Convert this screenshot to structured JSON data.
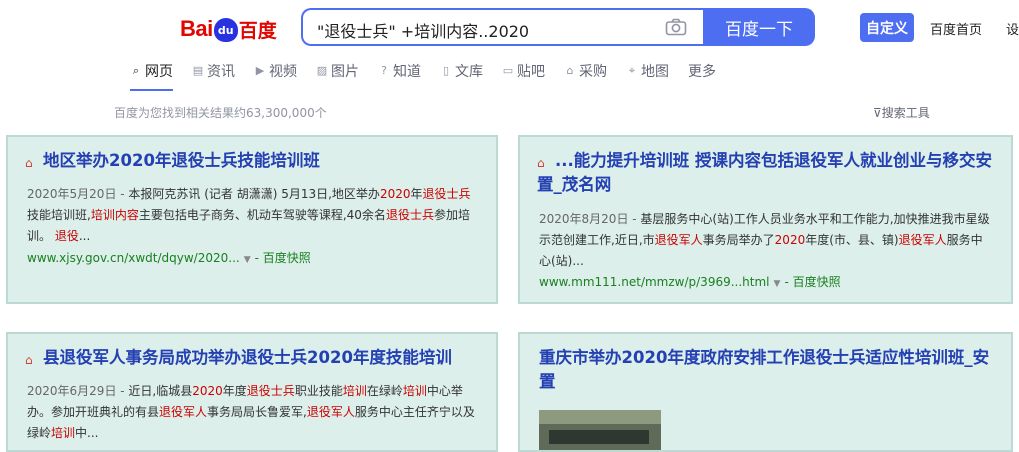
{
  "logo": {
    "text_bai": "Bai",
    "text_du": "du",
    "text_cn": "百度"
  },
  "search": {
    "query": "\"退役士兵\" +培训内容..2020",
    "button_label": "百度一下"
  },
  "header": {
    "custom_label": "自定义",
    "home_label": "百度首页",
    "settings_label": "设"
  },
  "tabs": [
    {
      "label": "网页",
      "icon": "search-icon",
      "active": true
    },
    {
      "label": "资讯",
      "icon": "news-icon"
    },
    {
      "label": "视频",
      "icon": "video-icon"
    },
    {
      "label": "图片",
      "icon": "image-icon"
    },
    {
      "label": "知道",
      "icon": "question-icon"
    },
    {
      "label": "文库",
      "icon": "document-icon"
    },
    {
      "label": "贴吧",
      "icon": "forum-icon"
    },
    {
      "label": "采购",
      "icon": "shopping-icon"
    },
    {
      "label": "地图",
      "icon": "map-icon"
    },
    {
      "label": "更多"
    }
  ],
  "results_info": {
    "count_text": "百度为您找到相关结果约63,300,000个",
    "tools_label": "搜索工具"
  },
  "results": [
    {
      "title": "地区举办2020年退役士兵技能培训班",
      "desc": [
        "2020年5月20日 - ",
        "本报阿克苏讯 (记者 胡潇潇) 5月13日,地区举办",
        "2020",
        "年",
        "退役士兵",
        "技能培训班,",
        "培训内容",
        "主要包括电子商务、机动车驾驶等课程,40余名",
        "退役士兵",
        "参加培训。 ",
        "退役",
        "..."
      ],
      "url": "www.xjsy.gov.cn/xwdt/dqyw/2020...",
      "snapshot": "百度快照"
    },
    {
      "title": "...能力提升培训班 授课内容包括退役军人就业创业与移交安置_茂名网",
      "desc": [
        "2020年8月20日 - ",
        "基层服务中心(站)工作人员业务水平和工作能力,加快推进我市星级示范创建工作,近日,市",
        "退役军人",
        "事务局举办了",
        "2020",
        "年度(市、县、镇)",
        "退役军人",
        "服务中心(站)..."
      ],
      "url": "www.mm111.net/mmzw/p/3969...html",
      "snapshot": "百度快照"
    },
    {
      "title": "县退役军人事务局成功举办退役士兵2020年度技能培训",
      "desc": [
        "2020年6月29日 - ",
        "近日,临城县",
        "2020",
        "年度",
        "退役士兵",
        "职业技能",
        "培训",
        "在绿岭",
        "培训",
        "中心举办。参加开班典礼的有县",
        "退役军人",
        "事务局局长鲁爱军,",
        "退役军人",
        "服务中心主任齐宁以及绿岭",
        "培训",
        "中..."
      ]
    },
    {
      "title": "重庆市举办2020年度政府安排工作退役士兵适应性培训班_安置"
    }
  ]
}
